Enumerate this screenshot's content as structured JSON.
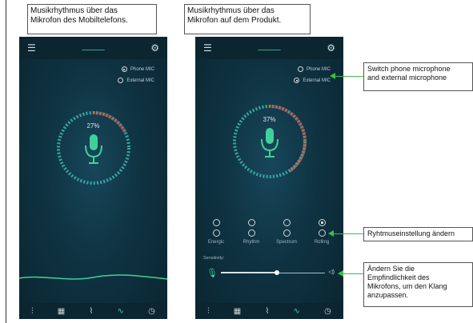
{
  "left_panel": {
    "caption": "Musikrhythmus über das\nMikrofon des Mobiltelefons.",
    "mic_options": [
      {
        "label": "Phone MIC",
        "selected": true
      },
      {
        "label": "External MIC",
        "selected": false
      }
    ],
    "percent": "27%"
  },
  "right_panel": {
    "caption": "Musikrhythmus über das\nMikrofon auf dem Produkt.",
    "mic_options": [
      {
        "label": "Phone MIC",
        "selected": false
      },
      {
        "label": "External MIC",
        "selected": true
      }
    ],
    "percent": "37%",
    "modes": [
      {
        "label": "Energic",
        "selected": false
      },
      {
        "label": "Rhythm",
        "selected": false
      },
      {
        "label": "Spectrum",
        "selected": false
      },
      {
        "label": "Rolling",
        "selected": true
      }
    ],
    "sensitivity_label": "Sensitivity:",
    "sensitivity_level": 0.5
  },
  "callouts": {
    "switch_mic": "Switch phone microphone\nand external microphone",
    "rhythm_setting": "Ryhtmuseinstellung ändern",
    "sensitivity": "Ändern Sie die\nEmpfindlichkeit des\nMikrofons, um den Klang\nanzupassen."
  },
  "colors": {
    "accent": "#3fd19a",
    "ring_teal": "#3aa8a0",
    "ring_red": "#d9473c",
    "callout_line": "#3bbf4a"
  },
  "icons": {
    "top": [
      "menu-icon",
      "pulse-icon",
      "gear-icon"
    ],
    "bottom": [
      "equalizer-icon",
      "grid-icon",
      "rhythm-icon",
      "pulse-icon",
      "timer-icon"
    ]
  }
}
